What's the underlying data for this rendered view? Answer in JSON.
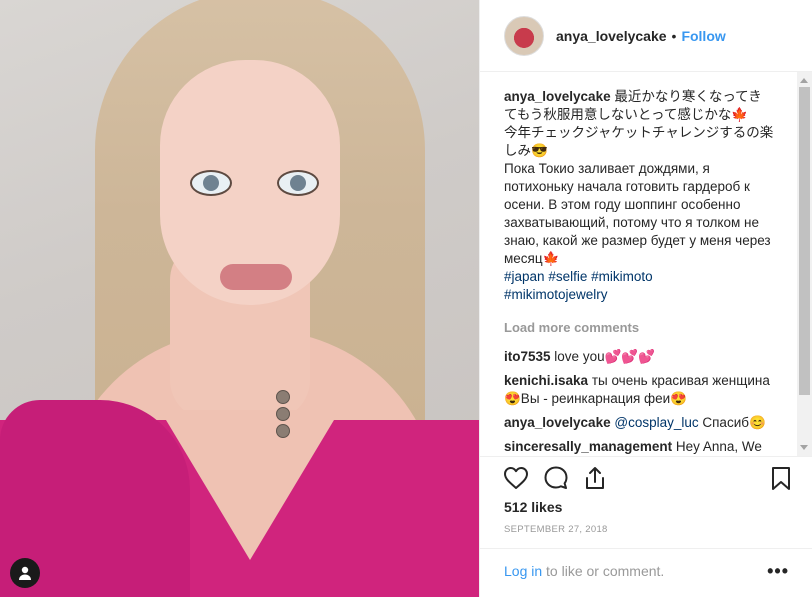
{
  "post": {
    "username": "anya_lovelycake",
    "follow_label": "Follow",
    "separator": "•"
  },
  "caption": {
    "username": "anya_lovelycake",
    "text_jp": "最近かなり寒くなってきてもう秋服用意しないとって感じかな🍁\n今年チェックジャケットチャレンジするの楽しみ😎",
    "text_ru": "Пока Токио заливает дождями, я потихоньку начала готовить гардероб к осени. В этом году шоппинг особенно захватывающий, потому что я толком не знаю, какой же размер будет у меня через месяц🍁",
    "tags": [
      "#japan",
      "#selfie",
      "#mikimoto",
      "#mikimotojewelry"
    ]
  },
  "load_more_label": "Load more comments",
  "comments": [
    {
      "user": "ito7535",
      "text": "love you💕💕💕"
    },
    {
      "user": "kenichi.isaka",
      "text": "ты очень красивая женщина😍Вы - реинкарнация феи😍"
    },
    {
      "user": "anya_lovelycake",
      "mention": "@cosplay_luc",
      "text": "Спасиб😊"
    },
    {
      "user": "sinceresally_management",
      "text": "Hey Anna, We should work & collab together! DM"
    }
  ],
  "likes": "512 likes",
  "date": "SEPTEMBER 27, 2018",
  "footer": {
    "login_label": "Log in",
    "login_rest": " to like or comment.",
    "more_label": "•••"
  },
  "icons": {
    "like": "heart-icon",
    "comment": "comment-icon",
    "share": "share-icon",
    "save": "bookmark-icon",
    "user_tag": "user-icon"
  },
  "colors": {
    "accent": "#3897f0",
    "hashtag": "#003569",
    "muted": "#999999",
    "dress": "#d0247d"
  }
}
